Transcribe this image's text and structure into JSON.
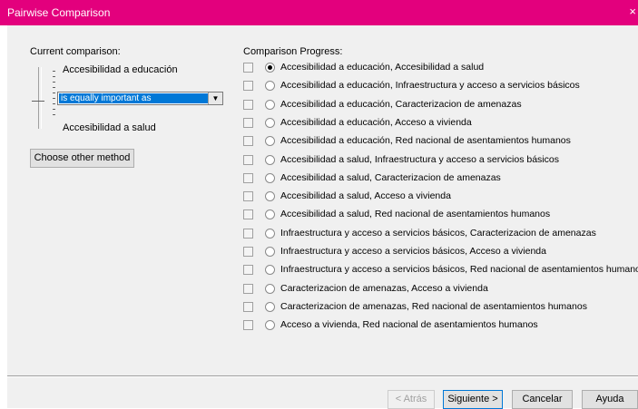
{
  "window": {
    "title": "Pairwise Comparison",
    "close_glyph": "×"
  },
  "left": {
    "current_label": "Current comparison:",
    "item_a": "Accesibilidad a educación",
    "item_b": "Accesibilidad a salud",
    "dropdown_value": "is equally important as",
    "choose_btn": "Choose other method"
  },
  "right": {
    "progress_label": "Comparison Progress:",
    "rows": [
      {
        "text": "Accesibilidad a educación, Accesibilidad a salud",
        "selected": true,
        "checked": false
      },
      {
        "text": "Accesibilidad a educación, Infraestructura y acceso a servicios básicos",
        "selected": false,
        "checked": false
      },
      {
        "text": "Accesibilidad a educación, Caracterizacion de amenazas",
        "selected": false,
        "checked": false
      },
      {
        "text": "Accesibilidad a educación, Acceso a vivienda",
        "selected": false,
        "checked": false
      },
      {
        "text": "Accesibilidad a educación, Red nacional de asentamientos humanos",
        "selected": false,
        "checked": false
      },
      {
        "text": "Accesibilidad a salud, Infraestructura y acceso a servicios básicos",
        "selected": false,
        "checked": false
      },
      {
        "text": "Accesibilidad a salud, Caracterizacion de amenazas",
        "selected": false,
        "checked": false
      },
      {
        "text": "Accesibilidad a salud, Acceso a vivienda",
        "selected": false,
        "checked": false
      },
      {
        "text": "Accesibilidad a salud, Red nacional de asentamientos humanos",
        "selected": false,
        "checked": false
      },
      {
        "text": "Infraestructura y acceso a servicios básicos, Caracterizacion de amenazas",
        "selected": false,
        "checked": false
      },
      {
        "text": "Infraestructura y acceso a servicios básicos, Acceso a vivienda",
        "selected": false,
        "checked": false
      },
      {
        "text": "Infraestructura y acceso a servicios básicos, Red nacional de asentamientos humanos",
        "selected": false,
        "checked": false
      },
      {
        "text": "Caracterizacion de amenazas, Acceso a vivienda",
        "selected": false,
        "checked": false
      },
      {
        "text": "Caracterizacion de amenazas, Red nacional de asentamientos humanos",
        "selected": false,
        "checked": false
      },
      {
        "text": "Acceso a vivienda, Red nacional de asentamientos humanos",
        "selected": false,
        "checked": false
      }
    ]
  },
  "footer": {
    "back": "< Atrás",
    "next": "Siguiente >",
    "cancel": "Cancelar",
    "help": "Ayuda"
  },
  "colors": {
    "titlebar": "#e3007d",
    "selection": "#0078d7"
  }
}
